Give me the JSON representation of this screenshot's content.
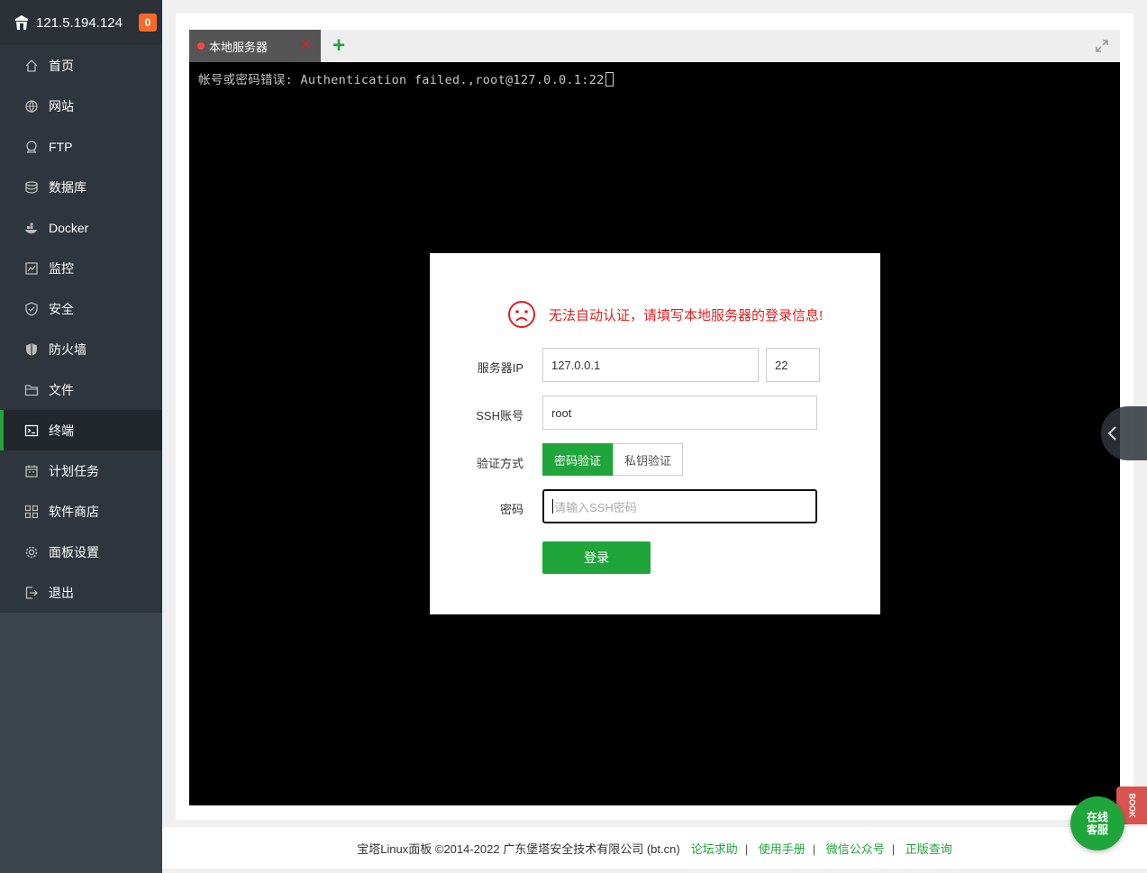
{
  "sidebar": {
    "server_ip": "121.5.194.124",
    "notification_count": "0",
    "items": [
      {
        "label": "首页",
        "icon": "home-icon"
      },
      {
        "label": "网站",
        "icon": "globe-icon"
      },
      {
        "label": "FTP",
        "icon": "ftp-icon"
      },
      {
        "label": "数据库",
        "icon": "database-icon"
      },
      {
        "label": "Docker",
        "icon": "docker-icon"
      },
      {
        "label": "监控",
        "icon": "monitor-icon"
      },
      {
        "label": "安全",
        "icon": "shield-check-icon"
      },
      {
        "label": "防火墙",
        "icon": "firewall-icon"
      },
      {
        "label": "文件",
        "icon": "folder-icon"
      },
      {
        "label": "终端",
        "icon": "terminal-icon",
        "active": true
      },
      {
        "label": "计划任务",
        "icon": "calendar-icon"
      },
      {
        "label": "软件商店",
        "icon": "apps-icon"
      },
      {
        "label": "面板设置",
        "icon": "gear-icon"
      },
      {
        "label": "退出",
        "icon": "logout-icon"
      }
    ]
  },
  "terminal": {
    "tab_label": "本地服务器",
    "output_line": "帐号或密码错误: Authentication failed.,root@127.0.0.1:22"
  },
  "login_dialog": {
    "message": "无法自动认证，请填写本地服务器的登录信息!",
    "server_ip_label": "服务器IP",
    "server_ip_value": "127.0.0.1",
    "port_value": "22",
    "ssh_account_label": "SSH账号",
    "ssh_account_value": "root",
    "auth_method_label": "验证方式",
    "auth_password_option": "密码验证",
    "auth_key_option": "私钥验证",
    "password_label": "密码",
    "password_placeholder": "请输入SSH密码",
    "login_button": "登录"
  },
  "footer": {
    "copyright": "宝塔Linux面板 ©2014-2022 广东堡塔安全技术有限公司 (bt.cn)",
    "links": [
      "论坛求助",
      "使用手册",
      "微信公众号",
      "正版查询"
    ]
  },
  "floating": {
    "service_line1": "在线",
    "service_line2": "客服",
    "book_label": "BOOK"
  },
  "colors": {
    "accent": "#20a53a",
    "error": "#e02020",
    "sidebar_bg": "#2f353c",
    "badge": "#f7692a"
  }
}
